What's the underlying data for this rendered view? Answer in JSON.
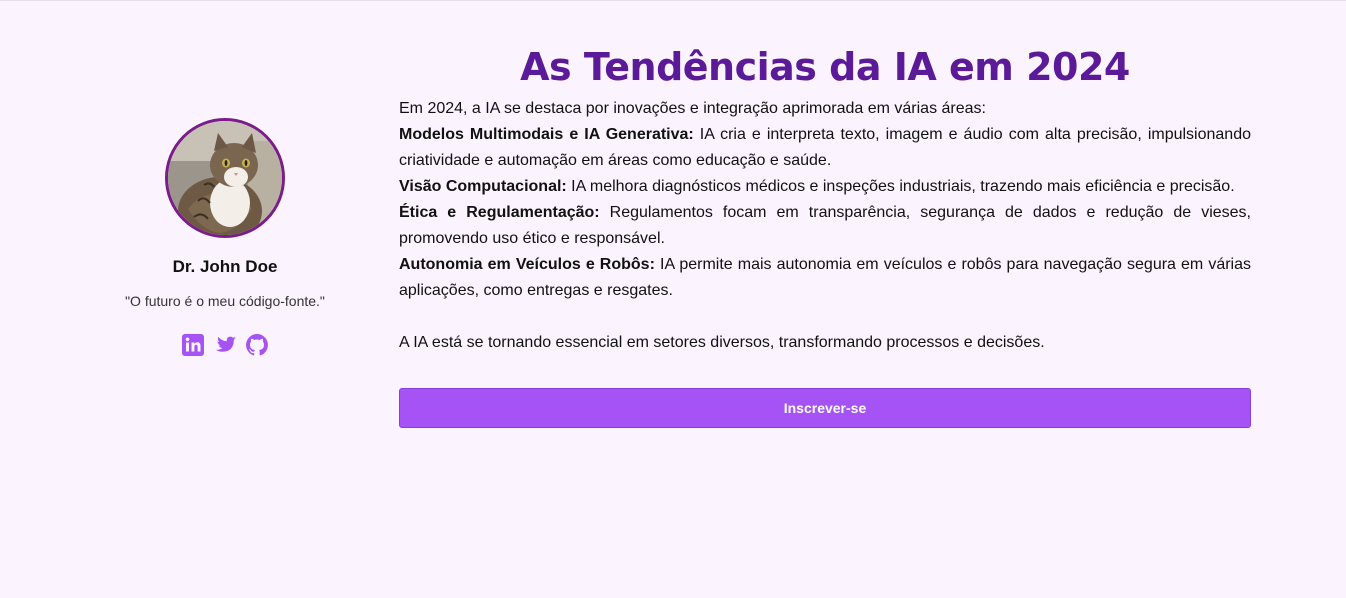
{
  "profile": {
    "name": "Dr. John Doe",
    "quote": "\"O futuro é o meu código-fonte.\"",
    "socials": [
      "linkedin-icon",
      "twitter-icon",
      "github-icon"
    ],
    "accent_color": "#a653f5"
  },
  "article": {
    "title": "As Tendências da IA em 2024",
    "intro": "Em 2024, a IA se destaca por inovações e integração aprimorada em várias áreas:",
    "items": [
      {
        "heading": "Modelos Multimodais e IA Generativa:",
        "text": " IA cria e interpreta texto, imagem e áudio com alta precisão, impulsionando criatividade e automação em áreas como educação e saúde."
      },
      {
        "heading": "Visão Computacional:",
        "text": " IA melhora diagnósticos médicos e inspeções industriais, trazendo mais eficiência e precisão."
      },
      {
        "heading": "Ética e Regulamentação:",
        "text": " Regulamentos focam em transparência, segurança de dados e redução de vieses, promovendo uso ético e responsável."
      },
      {
        "heading": "Autonomia em Veículos e Robôs:",
        "text": " IA permite mais autonomia em veículos e robôs para navegação segura em várias aplicações, como entregas e resgates."
      }
    ],
    "closing": "A IA está se tornando essencial em setores diversos, transformando processos e decisões."
  },
  "subscribe": {
    "label": "Inscrever-se"
  },
  "colors": {
    "background": "#fbf3fe",
    "title": "#5b1a97",
    "avatar_border": "#7a1c8a",
    "button": "#a653f5"
  }
}
